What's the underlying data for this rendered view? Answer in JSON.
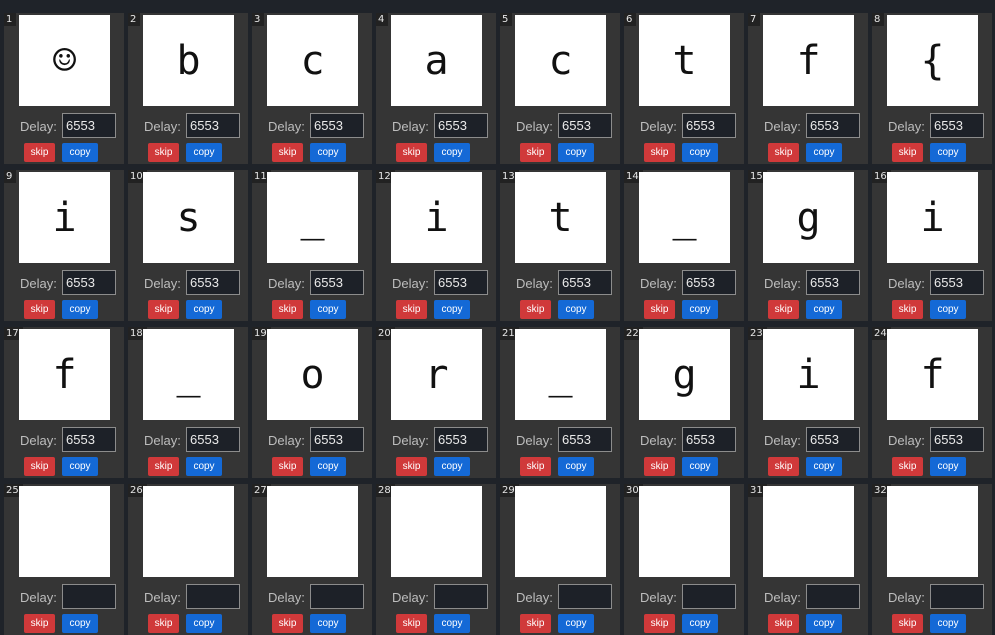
{
  "labels": {
    "delay": "Delay:",
    "skip": "skip",
    "copy": "copy"
  },
  "colors": {
    "background": "#1f2329",
    "frame": "#353535",
    "skip_button": "#d0393a",
    "copy_button": "#1469d6"
  },
  "frames": [
    {
      "index": "1",
      "char": "☺",
      "delay": "6553"
    },
    {
      "index": "2",
      "char": "b",
      "delay": "6553"
    },
    {
      "index": "3",
      "char": "c",
      "delay": "6553"
    },
    {
      "index": "4",
      "char": "a",
      "delay": "6553"
    },
    {
      "index": "5",
      "char": "c",
      "delay": "6553"
    },
    {
      "index": "6",
      "char": "t",
      "delay": "6553"
    },
    {
      "index": "7",
      "char": "f",
      "delay": "6553"
    },
    {
      "index": "8",
      "char": "{",
      "delay": "6553"
    },
    {
      "index": "9",
      "char": "i",
      "delay": "6553"
    },
    {
      "index": "10",
      "char": "s",
      "delay": "6553"
    },
    {
      "index": "11",
      "char": "_",
      "delay": "6553"
    },
    {
      "index": "12",
      "char": "i",
      "delay": "6553"
    },
    {
      "index": "13",
      "char": "t",
      "delay": "6553"
    },
    {
      "index": "14",
      "char": "_",
      "delay": "6553"
    },
    {
      "index": "15",
      "char": "g",
      "delay": "6553"
    },
    {
      "index": "16",
      "char": "i",
      "delay": "6553"
    },
    {
      "index": "17",
      "char": "f",
      "delay": "6553"
    },
    {
      "index": "18",
      "char": "_",
      "delay": "6553"
    },
    {
      "index": "19",
      "char": "o",
      "delay": "6553"
    },
    {
      "index": "20",
      "char": "r",
      "delay": "6553"
    },
    {
      "index": "21",
      "char": "_",
      "delay": "6553"
    },
    {
      "index": "22",
      "char": "g",
      "delay": "6553"
    },
    {
      "index": "23",
      "char": "i",
      "delay": "6553"
    },
    {
      "index": "24",
      "char": "f",
      "delay": "6553"
    },
    {
      "index": "25",
      "char": "",
      "delay": ""
    },
    {
      "index": "26",
      "char": "",
      "delay": ""
    },
    {
      "index": "27",
      "char": "",
      "delay": ""
    },
    {
      "index": "28",
      "char": "",
      "delay": ""
    },
    {
      "index": "29",
      "char": "",
      "delay": ""
    },
    {
      "index": "30",
      "char": "",
      "delay": ""
    },
    {
      "index": "31",
      "char": "",
      "delay": ""
    },
    {
      "index": "32",
      "char": "",
      "delay": ""
    }
  ]
}
